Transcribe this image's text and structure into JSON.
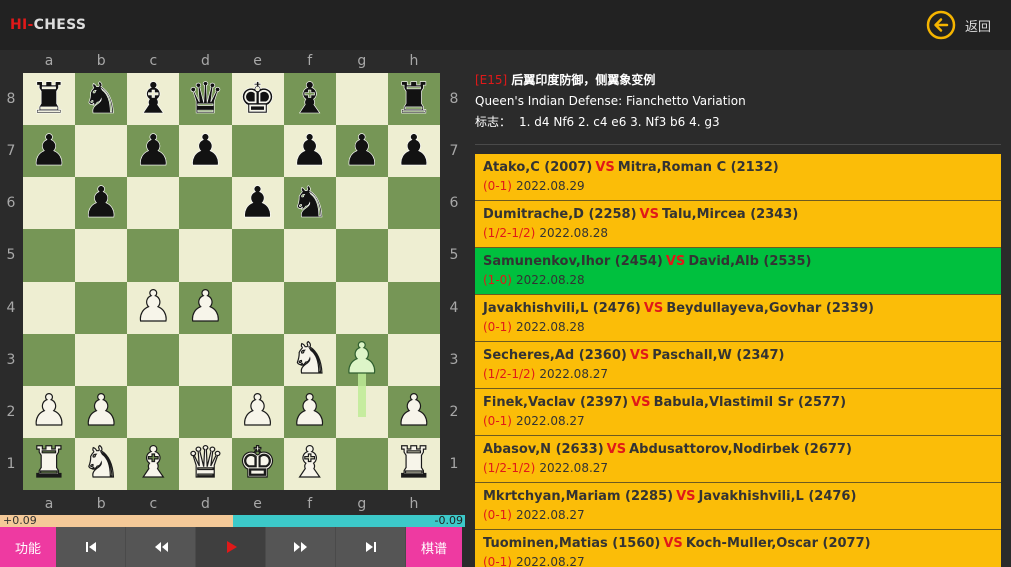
{
  "app": {
    "logo_hi": "HI-",
    "logo_chess": "CHESS",
    "back_label": "返回",
    "accent": "#f5b400"
  },
  "board": {
    "files": [
      "a",
      "b",
      "c",
      "d",
      "e",
      "f",
      "g",
      "h"
    ],
    "ranks": [
      "8",
      "7",
      "6",
      "5",
      "4",
      "3",
      "2",
      "1"
    ],
    "position": [
      [
        "bR",
        "bN",
        "bB",
        "bQ",
        "bK",
        "bB",
        "",
        "bR"
      ],
      [
        "bP",
        "",
        "bP",
        "bP",
        "",
        "bP",
        "bP",
        "bP"
      ],
      [
        "",
        "bP",
        "",
        "",
        "bP",
        "bN",
        "",
        ""
      ],
      [
        "",
        "",
        "",
        "",
        "",
        "",
        "",
        ""
      ],
      [
        "",
        "",
        "wP",
        "wP",
        "",
        "",
        "",
        ""
      ],
      [
        "",
        "",
        "",
        "",
        "",
        "wN",
        "wP",
        ""
      ],
      [
        "wP",
        "wP",
        "",
        "",
        "wP",
        "wP",
        "",
        "wP"
      ],
      [
        "wR",
        "wN",
        "wB",
        "wQ",
        "wK",
        "wB",
        "",
        "wR"
      ]
    ],
    "last_move": {
      "from": "g2",
      "to": "g3"
    },
    "light_color": "#eeeed2",
    "dark_color": "#769656"
  },
  "eval": {
    "white_label": "+0.09",
    "black_label": "-0.09",
    "white_share": 0.5
  },
  "controls": {
    "function_label": "功能",
    "manual_label": "棋谱"
  },
  "opening": {
    "code": "[E15]",
    "name_cn": "后翼印度防御，侧翼象变例",
    "name_en": "Queen's Indian Defense: Fianchetto Variation",
    "marker_label": "标志：",
    "moves": "1. d4 Nf6 2. c4 e6 3. Nf3 b6 4. g3"
  },
  "games": [
    {
      "white": "Atako,C (2007)",
      "vs": "VS",
      "black": "Mitra,Roman C (2132)",
      "result": "(0-1)",
      "date": "2022.08.29",
      "active": false
    },
    {
      "white": "Dumitrache,D (2258)",
      "vs": "VS",
      "black": "Talu,Mircea (2343)",
      "result": "(1/2-1/2)",
      "date": "2022.08.28",
      "active": false
    },
    {
      "white": "Samunenkov,Ihor (2454)",
      "vs": "VS",
      "black": "David,Alb (2535)",
      "result": "(1-0)",
      "date": "2022.08.28",
      "active": true
    },
    {
      "white": "Javakhishvili,L (2476)",
      "vs": "VS",
      "black": "Beydullayeva,Govhar (2339)",
      "result": "(0-1)",
      "date": "2022.08.28",
      "active": false
    },
    {
      "white": "Secheres,Ad (2360)",
      "vs": "VS",
      "black": "Paschall,W (2347)",
      "result": "(1/2-1/2)",
      "date": "2022.08.27",
      "active": false
    },
    {
      "white": "Finek,Vaclav (2397)",
      "vs": "VS",
      "black": "Babula,Vlastimil Sr (2577)",
      "result": "(0-1)",
      "date": "2022.08.27",
      "active": false
    },
    {
      "white": "Abasov,N (2633)",
      "vs": "VS",
      "black": "Abdusattorov,Nodirbek (2677)",
      "result": "(1/2-1/2)",
      "date": "2022.08.27",
      "active": false
    },
    {
      "white": "Mkrtchyan,Mariam (2285)",
      "vs": "VS",
      "black": "Javakhishvili,L (2476)",
      "result": "(0-1)",
      "date": "2022.08.27",
      "active": false
    },
    {
      "white": "Tuominen,Matias (1560)",
      "vs": "VS",
      "black": "Koch-Muller,Oscar (2077)",
      "result": "(0-1)",
      "date": "2022.08.27",
      "active": false
    }
  ]
}
